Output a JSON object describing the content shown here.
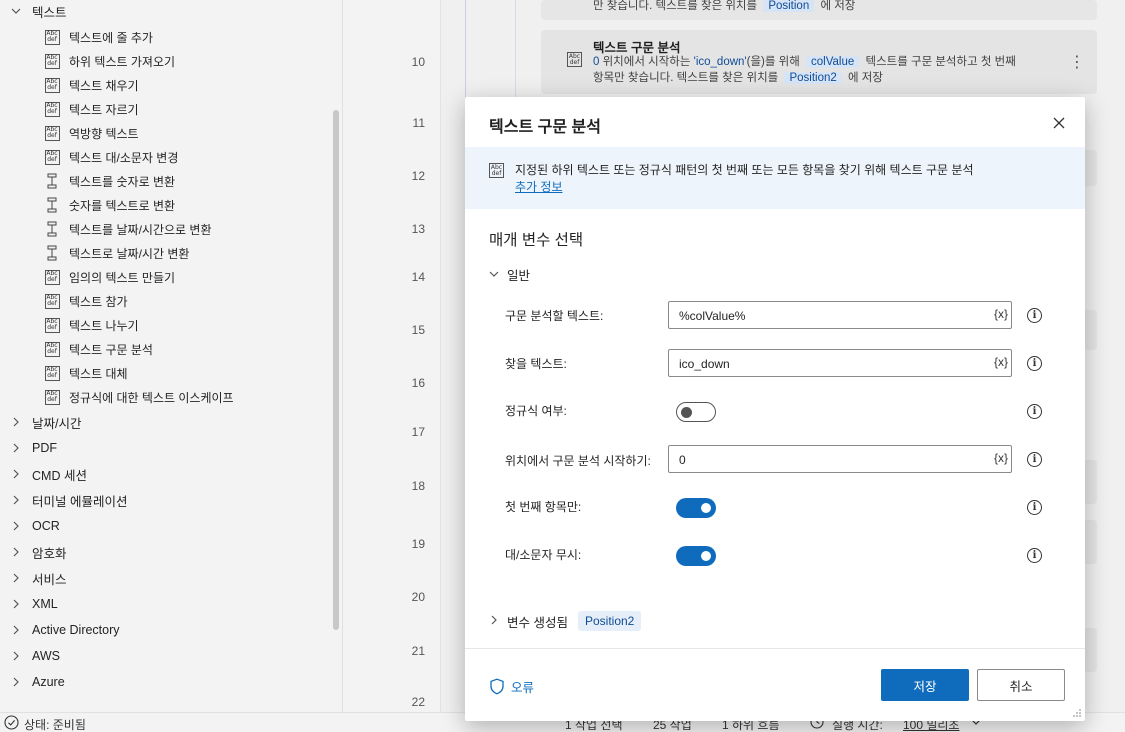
{
  "left_panel": {
    "text_group": {
      "label": "텍스트"
    },
    "text_items": [
      {
        "label": "텍스트에 줄 추가",
        "icon": "abc-def-icon"
      },
      {
        "label": "하위 텍스트 가져오기",
        "icon": "abc-def-icon"
      },
      {
        "label": "텍스트 채우기",
        "icon": "abc-def-icon"
      },
      {
        "label": "텍스트 자르기",
        "icon": "abc-def-icon"
      },
      {
        "label": "역방향 텍스트",
        "icon": "abc-def-icon"
      },
      {
        "label": "텍스트 대/소문자 변경",
        "icon": "abc-def-icon"
      },
      {
        "label": "텍스트를 숫자로 변환",
        "icon": "convert-icon"
      },
      {
        "label": "숫자를 텍스트로 변환",
        "icon": "convert-icon"
      },
      {
        "label": "텍스트를 날짜/시간으로 변환",
        "icon": "convert-icon"
      },
      {
        "label": "텍스트로 날짜/시간 변환",
        "icon": "convert-icon"
      },
      {
        "label": "임의의 텍스트 만들기",
        "icon": "abc-def-icon"
      },
      {
        "label": "텍스트 참가",
        "icon": "abc-def-icon"
      },
      {
        "label": "텍스트 나누기",
        "icon": "abc-def-icon"
      },
      {
        "label": "텍스트 구문 분석",
        "icon": "abc-def-icon"
      },
      {
        "label": "텍스트 대체",
        "icon": "abc-def-icon"
      },
      {
        "label": "정규식에 대한 텍스트 이스케이프",
        "icon": "abc-def-icon"
      }
    ],
    "collapsed_groups": [
      {
        "label": "날짜/시간"
      },
      {
        "label": "PDF"
      },
      {
        "label": "CMD 세션"
      },
      {
        "label": "터미널 에뮬레이션"
      },
      {
        "label": "OCR"
      },
      {
        "label": "암호화"
      },
      {
        "label": "서비스"
      },
      {
        "label": "XML"
      },
      {
        "label": "Active Directory"
      },
      {
        "label": "AWS"
      },
      {
        "label": "Azure"
      }
    ]
  },
  "flow": {
    "line_numbers": [
      "10",
      "11",
      "12",
      "13",
      "14",
      "15",
      "16",
      "17",
      "18",
      "19",
      "20",
      "21",
      "22"
    ],
    "top_card_desc_tail": "만 찾습니다. 텍스트를 찾은 위치를",
    "top_card_var": "Position",
    "top_card_desc_end": "에 저장",
    "card": {
      "title": "텍스트 구문 분석",
      "pos": "0",
      "desc_a": " 위치에서 시작하는 ",
      "find": "'ico_down'",
      "desc_b": "(을)를 위해",
      "var_in": "colValue",
      "desc_c": "텍스트를 구문 분석하고 첫 번째",
      "desc_d": "항목만 찾습니다. 텍스트를 찾은 위치를",
      "var_out": "Position2",
      "desc_e": "에 저장"
    }
  },
  "statusbar": {
    "status": "상태: 준비됨",
    "selected": "1 작업 선택",
    "actions": "25 작업",
    "subflows": "1 하위 흐름",
    "runtime_label": "실행 시간:",
    "runtime_value": "100 밀리초"
  },
  "dialog": {
    "title": "텍스트 구문 분석",
    "info_text": "지정된 하위 텍스트 또는 정규식 패턴의 첫 번째 또는 모든 항목을 찾기 위해 텍스트 구문 분석",
    "info_link": "추가 정보",
    "params_title": "매개 변수 선택",
    "general_label": "일반",
    "fields": {
      "text_to_parse": {
        "label": "구문 분석할 텍스트:",
        "value": "%colValue%",
        "var_button": "{x}"
      },
      "text_to_find": {
        "label": "찾을 텍스트:",
        "value": "ico_down",
        "var_button": "{x}"
      },
      "is_regex": {
        "label": "정규식 여부:",
        "on": false
      },
      "start_position": {
        "label": "위치에서 구문 분석 시작하기:",
        "value": "0",
        "var_button": "{x}"
      },
      "first_only": {
        "label": "첫 번째 항목만:",
        "on": true
      },
      "ignore_case": {
        "label": "대/소문자 무시:",
        "on": true
      }
    },
    "info_glyph": "i",
    "vars_label": "변수 생성됨",
    "vars_pill": "Position2",
    "error_label": "오류",
    "save_label": "저장",
    "cancel_label": "취소"
  },
  "colors": {
    "accent": "#0f6cbd",
    "variable_pill_bg": "#d6e4f5",
    "variable_pill_text": "#0f4c96"
  }
}
